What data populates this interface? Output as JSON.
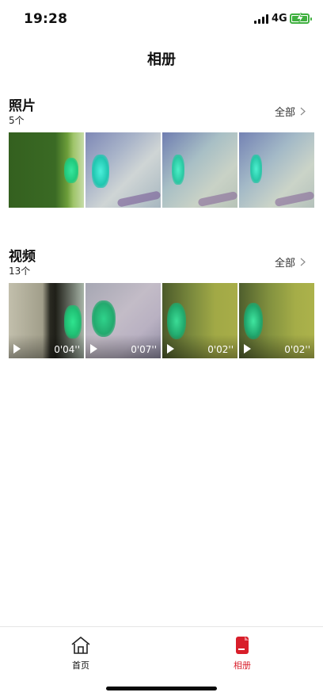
{
  "status_bar": {
    "time": "19:28",
    "network": "4G",
    "signal_icon": "signal-bars-icon",
    "battery_icon": "battery-charging-icon",
    "battery_color": "#3fb03f"
  },
  "header": {
    "title": "相册"
  },
  "photos": {
    "title": "照片",
    "count": "5个",
    "see_all": "全部",
    "see_all_icon": "chevron-right-icon"
  },
  "videos": {
    "title": "视频",
    "count": "13个",
    "see_all": "全部",
    "see_all_icon": "chevron-right-icon",
    "items": [
      {
        "duration": "0'04''",
        "play_icon": "play-icon"
      },
      {
        "duration": "0'07''",
        "play_icon": "play-icon"
      },
      {
        "duration": "0'02''",
        "play_icon": "play-icon"
      },
      {
        "duration": "0'02''",
        "play_icon": "play-icon"
      }
    ]
  },
  "tabbar": {
    "home_label": "首页",
    "home_icon": "home-icon",
    "album_label": "相册",
    "album_icon": "album-icon",
    "active_color": "#d81e2a"
  }
}
